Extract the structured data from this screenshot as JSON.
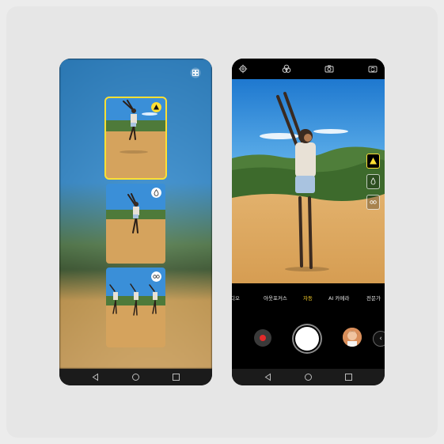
{
  "left_phone": {
    "layout_icon": "grid-icon",
    "thumbnails": [
      {
        "scene": "person-arms-up",
        "mode_icon": "warning-triangle-icon",
        "selected": true
      },
      {
        "scene": "person-arms-up",
        "mode_icon": "drop-icon",
        "selected": false
      },
      {
        "scene": "multiple-persons",
        "mode_icon": "infinity-icon",
        "selected": false
      }
    ],
    "nav": [
      "back-icon",
      "home-icon",
      "recents-icon"
    ]
  },
  "right_phone": {
    "top_icons": [
      "settings-icon",
      "filter-icon",
      "camera-icon",
      "flip-camera-icon"
    ],
    "side_buttons": [
      "warning-triangle-icon",
      "drop-icon",
      "infinity-icon"
    ],
    "modes": [
      {
        "label": "디오",
        "active": false
      },
      {
        "label": "아웃포커스",
        "active": false
      },
      {
        "label": "자동",
        "active": true
      },
      {
        "label": "AI 카메라",
        "active": false
      },
      {
        "label": "전문가",
        "active": false
      }
    ],
    "accent_color": "#f4cd2a",
    "nav": [
      "back-icon",
      "home-icon",
      "recents-icon"
    ]
  }
}
